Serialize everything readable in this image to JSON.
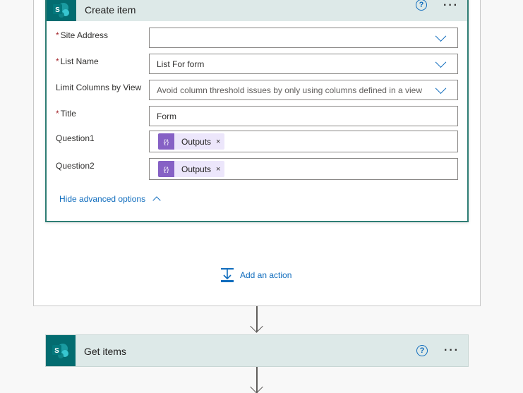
{
  "create_item": {
    "title": "Create item",
    "help_glyph": "?",
    "more_glyph": "···",
    "logo_letter": "S",
    "fields": [
      {
        "label": "Site Address",
        "required": true,
        "value": ""
      },
      {
        "label": "List Name",
        "required": true,
        "value": "List For form"
      },
      {
        "label": "Limit Columns by View",
        "required": false,
        "value": "Avoid column threshold issues by only using columns defined in a view"
      },
      {
        "label": "Title",
        "required": true,
        "value": "Form"
      }
    ],
    "questions": [
      {
        "label": "Question1",
        "token": "Outputs"
      },
      {
        "label": "Question2",
        "token": "Outputs"
      }
    ],
    "token_icon_glyph": "{⁄}",
    "token_close_glyph": "×",
    "required_mark": "*",
    "hide_advanced_label": "Hide advanced options"
  },
  "add_action_label": "Add an action",
  "get_items": {
    "title": "Get items",
    "help_glyph": "?",
    "more_glyph": "···",
    "logo_letter": "S"
  },
  "colors": {
    "accent_teal": "#036c70",
    "header_bg": "#dde9e8",
    "link_blue": "#0f6cbd",
    "token_purple": "#8661c5",
    "required_red": "#a4262c"
  }
}
